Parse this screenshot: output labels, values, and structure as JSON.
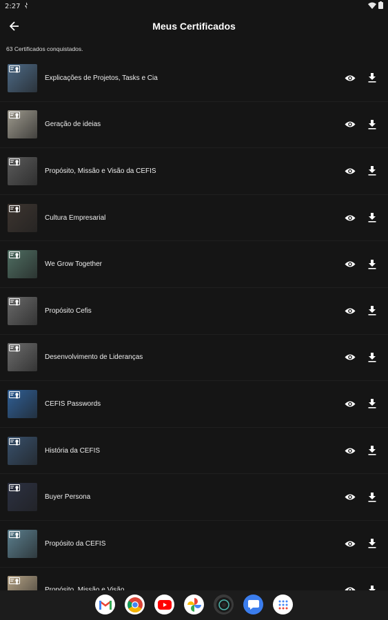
{
  "status_bar": {
    "time": "2:27"
  },
  "header": {
    "title": "Meus Certificados"
  },
  "summary": {
    "count_text": "63 Certificados conquistados."
  },
  "certificates": [
    {
      "title": "Explicações de Projetos, Tasks e Cia",
      "thumb_color": "#4d6a86"
    },
    {
      "title": "Geração de ideias",
      "thumb_color": "#9e9a8e"
    },
    {
      "title": "Propósito, Missão e Visão da CEFIS",
      "thumb_color": "#5b5b5b"
    },
    {
      "title": "Cultura Empresarial",
      "thumb_color": "#3d3530"
    },
    {
      "title": "We Grow Together",
      "thumb_color": "#4f6e62"
    },
    {
      "title": "Propósito Cefis",
      "thumb_color": "#6a6a6a"
    },
    {
      "title": "Desenvolvimento de Lideranças",
      "thumb_color": "#6d6d6d"
    },
    {
      "title": "CEFIS Passwords",
      "thumb_color": "#2f5f95"
    },
    {
      "title": "História da CEFIS",
      "thumb_color": "#38506b"
    },
    {
      "title": "Buyer Persona",
      "thumb_color": "#2c3142"
    },
    {
      "title": "Propósito da CEFIS",
      "thumb_color": "#5b7f8e"
    },
    {
      "title": "Propósito, Missão e Visão",
      "thumb_color": "#b4a285"
    }
  ],
  "dock_apps": [
    {
      "name": "gmail-app",
      "color": "#ffffff"
    },
    {
      "name": "chrome-app",
      "color": "#ffffff"
    },
    {
      "name": "youtube-app",
      "color": "#ffffff"
    },
    {
      "name": "photos-app",
      "color": "#ffffff"
    },
    {
      "name": "camera-app",
      "color": "#3a3a3a"
    },
    {
      "name": "messages-app",
      "color": "#3b7ded"
    },
    {
      "name": "app-drawer",
      "color": "#ffffff"
    }
  ]
}
